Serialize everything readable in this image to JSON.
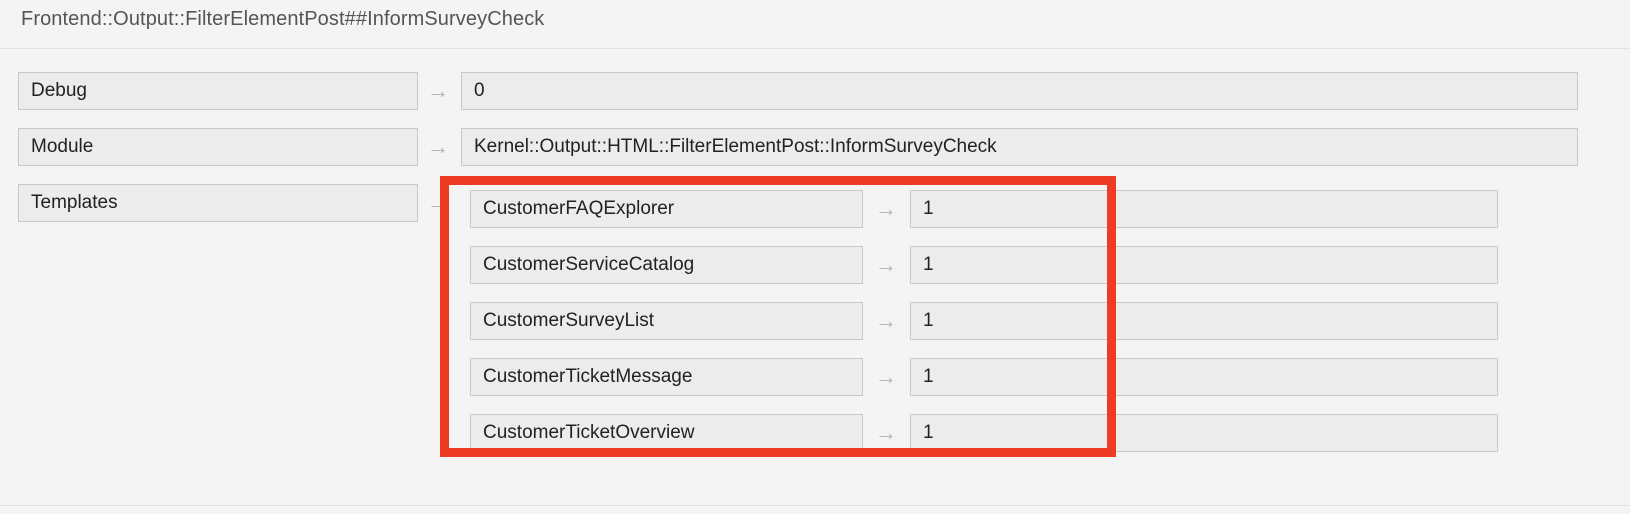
{
  "header": {
    "title": "Frontend::Output::FilterElementPost##InformSurveyCheck"
  },
  "icons": {
    "arrow": "→"
  },
  "colors": {
    "highlight": "#ee3b24",
    "field_background": "#ececec",
    "field_border": "#c9c9c9",
    "page_background": "#f4f4f4",
    "title_text": "#555555"
  },
  "rows": [
    {
      "label": "Debug",
      "value": "0"
    },
    {
      "label": "Module",
      "value": "Kernel::Output::HTML::FilterElementPost::InformSurveyCheck"
    },
    {
      "label": "Templates",
      "value": ""
    }
  ],
  "templates": [
    {
      "name": "CustomerFAQExplorer",
      "value": "1"
    },
    {
      "name": "CustomerServiceCatalog",
      "value": "1"
    },
    {
      "name": "CustomerSurveyList",
      "value": "1"
    },
    {
      "name": "CustomerTicketMessage",
      "value": "1"
    },
    {
      "name": "CustomerTicketOverview",
      "value": "1"
    }
  ]
}
